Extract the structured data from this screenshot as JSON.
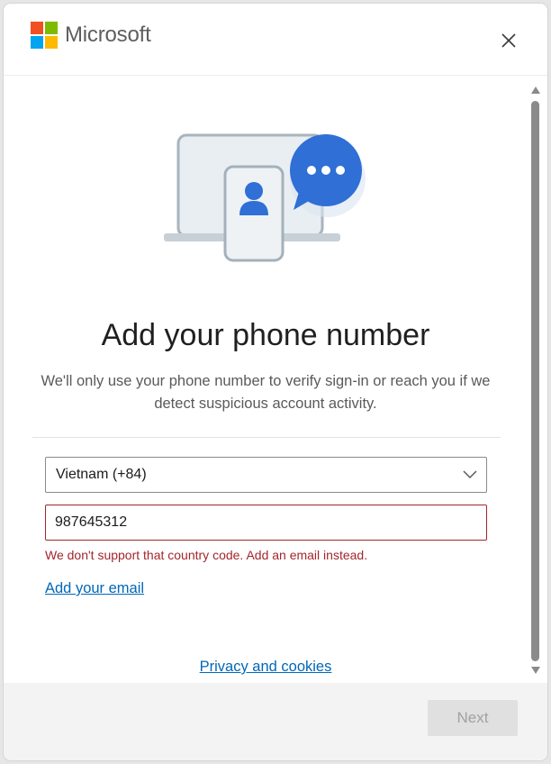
{
  "header": {
    "brand": "Microsoft",
    "logo_colors": [
      "#f25022",
      "#7fba00",
      "#00a4ef",
      "#ffb900"
    ]
  },
  "main": {
    "title": "Add your phone number",
    "description": "We'll only use your phone number to verify sign-in or reach you if we detect suspicious account activity.",
    "country_select": {
      "value": "Vietnam (+84)"
    },
    "phone_input": {
      "value": "987645312"
    },
    "error_message": "We don't support that country code. Add an email instead.",
    "add_email_link": "Add your email",
    "privacy_link": "Privacy and cookies"
  },
  "footer": {
    "next_label": "Next",
    "next_enabled": false
  },
  "colors": {
    "accent": "#0067b8",
    "error": "#a4262c",
    "illustration_blue": "#2f6fd6"
  }
}
